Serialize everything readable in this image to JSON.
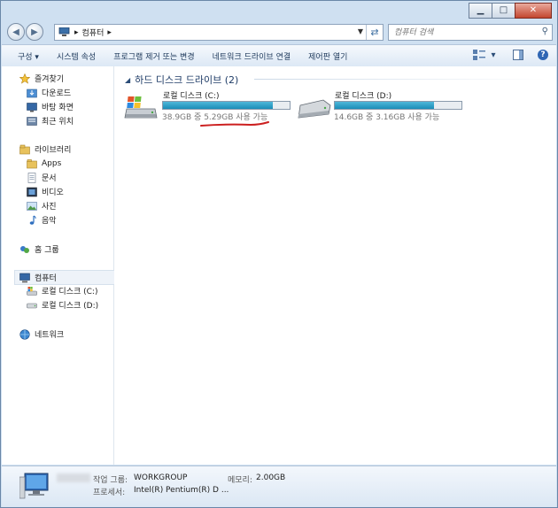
{
  "window": {
    "minimize_label": "▁",
    "maximize_label": "□",
    "close_label": "✕"
  },
  "address": {
    "root_icon": "computer-icon",
    "path_segment": "컴퓨터",
    "separator": "▸",
    "search_placeholder": "컴퓨터 검색"
  },
  "toolbar": {
    "organize": "구성 ▾",
    "system_properties": "시스템 속성",
    "uninstall": "프로그램 제거 또는 변경",
    "map_network_drive": "네트워크 드라이브 연결",
    "control_panel": "제어판 열기"
  },
  "sidebar": {
    "favorites": "즐겨찾기",
    "downloads": "다운로드",
    "desktop": "바탕 화면",
    "recent": "최근 위치",
    "libraries": "라이브러리",
    "apps": "Apps",
    "documents": "문서",
    "videos": "비디오",
    "pictures": "사진",
    "music": "음악",
    "homegroup": "홈 그룹",
    "computer": "컴퓨터",
    "drive_c": "로컬 디스크 (C:)",
    "drive_d": "로컬 디스크 (D:)",
    "network": "네트워크"
  },
  "main": {
    "group_title": "하드 디스크 드라이브 (2)",
    "drives": [
      {
        "name": "로컬 디스크 (C:)",
        "free_text": "38.9GB 중 5.29GB 사용 가능",
        "used_fraction": 0.864
      },
      {
        "name": "로컬 디스크 (D:)",
        "free_text": "14.6GB 중 3.16GB 사용 가능",
        "used_fraction": 0.784
      }
    ]
  },
  "details": {
    "workgroup_label": "작업 그룹:",
    "workgroup_value": "WORKGROUP",
    "memory_label": "메모리:",
    "memory_value": "2.00GB",
    "processor_label": "프로세서:",
    "processor_value": "Intel(R) Pentium(R) D   ..."
  },
  "colors": {
    "accent": "#1e3b66",
    "bar_fill": "#26a0cc",
    "annotation": "#cc1f1f"
  }
}
